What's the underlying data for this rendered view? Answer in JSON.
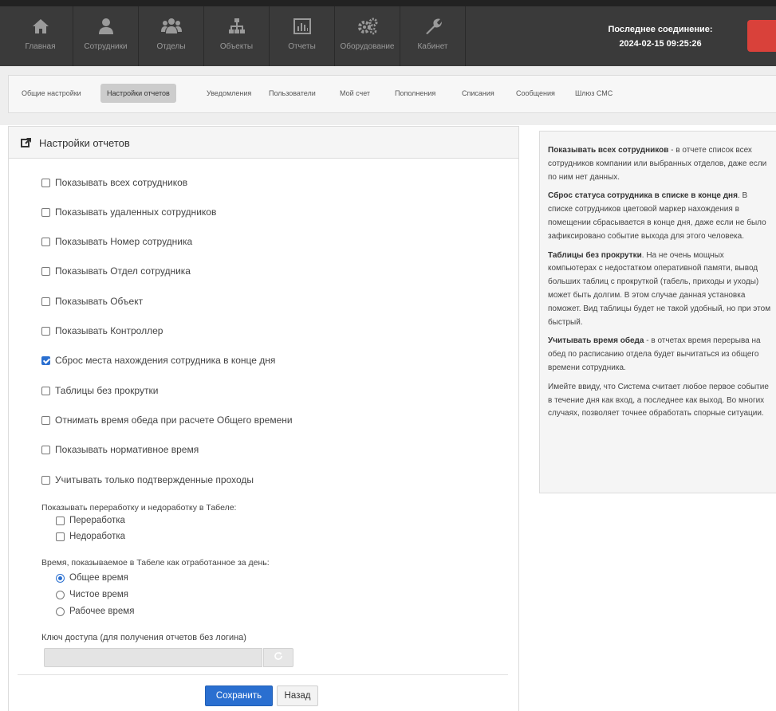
{
  "nav": {
    "items": [
      {
        "label": "Главная",
        "icon": "home-icon"
      },
      {
        "label": "Сотрудники",
        "icon": "user-icon"
      },
      {
        "label": "Отделы",
        "icon": "group-icon"
      },
      {
        "label": "Объекты",
        "icon": "sitemap-icon"
      },
      {
        "label": "Отчеты",
        "icon": "chart-icon"
      },
      {
        "label": "Оборудование",
        "icon": "gears-icon"
      },
      {
        "label": "Кабинет",
        "icon": "wrench-icon"
      }
    ],
    "connection_label": "Последнее соединение:",
    "connection_time": "2024-02-15 09:25:26"
  },
  "tabs": [
    {
      "label": "Общие настройки",
      "active": false
    },
    {
      "label": "Настройки отчетов",
      "active": true
    },
    {
      "label": "Уведомления",
      "active": false
    },
    {
      "label": "Пользователи",
      "active": false
    },
    {
      "label": "Мой счет",
      "active": false
    },
    {
      "label": "Пополнения",
      "active": false
    },
    {
      "label": "Списания",
      "active": false
    },
    {
      "label": "Сообщения",
      "active": false
    },
    {
      "label": "Шлюз СМС",
      "active": false
    }
  ],
  "panel": {
    "title": "Настройки отчетов",
    "checkboxes": [
      {
        "label": "Показывать всех сотрудников",
        "checked": false
      },
      {
        "label": "Показывать удаленных сотрудников",
        "checked": false
      },
      {
        "label": "Показывать Номер сотрудника",
        "checked": false
      },
      {
        "label": "Показывать Отдел сотрудника",
        "checked": false
      },
      {
        "label": "Показывать Объект",
        "checked": false
      },
      {
        "label": "Показывать Контроллер",
        "checked": false
      },
      {
        "label": "Сброс места нахождения сотрудника в конце дня",
        "checked": true
      },
      {
        "label": "Таблицы без прокрутки",
        "checked": false
      },
      {
        "label": "Отнимать время обеда при расчете Общего времени",
        "checked": false
      },
      {
        "label": "Показывать нормативное время",
        "checked": false
      },
      {
        "label": "Учитывать только подтвержденные проходы",
        "checked": false
      }
    ],
    "overtime_label": "Показывать переработку и недоработку в Табеле:",
    "overtime_options": [
      {
        "label": "Переработка",
        "checked": false
      },
      {
        "label": "Недоработка",
        "checked": false
      }
    ],
    "time_label": "Время, показываемое в Табеле как отработанное за день:",
    "time_options": [
      {
        "label": "Общее время",
        "checked": true
      },
      {
        "label": "Чистое время",
        "checked": false
      },
      {
        "label": "Рабочее время",
        "checked": false
      }
    ],
    "key_label": "Ключ доступа (для получения отчетов без логина)",
    "key_value": "",
    "save_label": "Сохранить",
    "back_label": "Назад"
  },
  "help": {
    "p1_bold": "Показывать всех сотрудников",
    "p1_text": " - в отчете список всех сотрудников компании или выбранных отделов, даже если по ним нет данных.",
    "p2_bold": "Сброс статуса сотрудника в списке в конце дня",
    "p2_text": ". В списке сотрудников цветовой маркер нахождения в помещении сбрасывается в конце дня, даже если не было зафиксировано событие выхода для этого человека.",
    "p3_bold": "Таблицы без прокрутки",
    "p3_text": ". На не очень мощных компьютерах с недостатком оперативной памяти, вывод больших таблиц с прокруткой (табель, приходы и уходы) может быть долгим. В этом случае данная установка поможет. Вид таблицы будет не такой удобный, но при этом быстрый.",
    "p4_bold": "Учитывать время обеда",
    "p4_text": " - в отчетах время перерыва на обед по расписанию отдела будет вычитаться из общего времени сотрудника.",
    "p5_text": "Имейте ввиду, что Система считает любое первое событие в течение дня как вход, а последнее как выход. Во многих случаях, позволяет точнее обработать спорные ситуации."
  },
  "colors": {
    "navbar": "#3a3a3a",
    "accent": "#2a6fd0",
    "alert_red": "#d9413a"
  }
}
